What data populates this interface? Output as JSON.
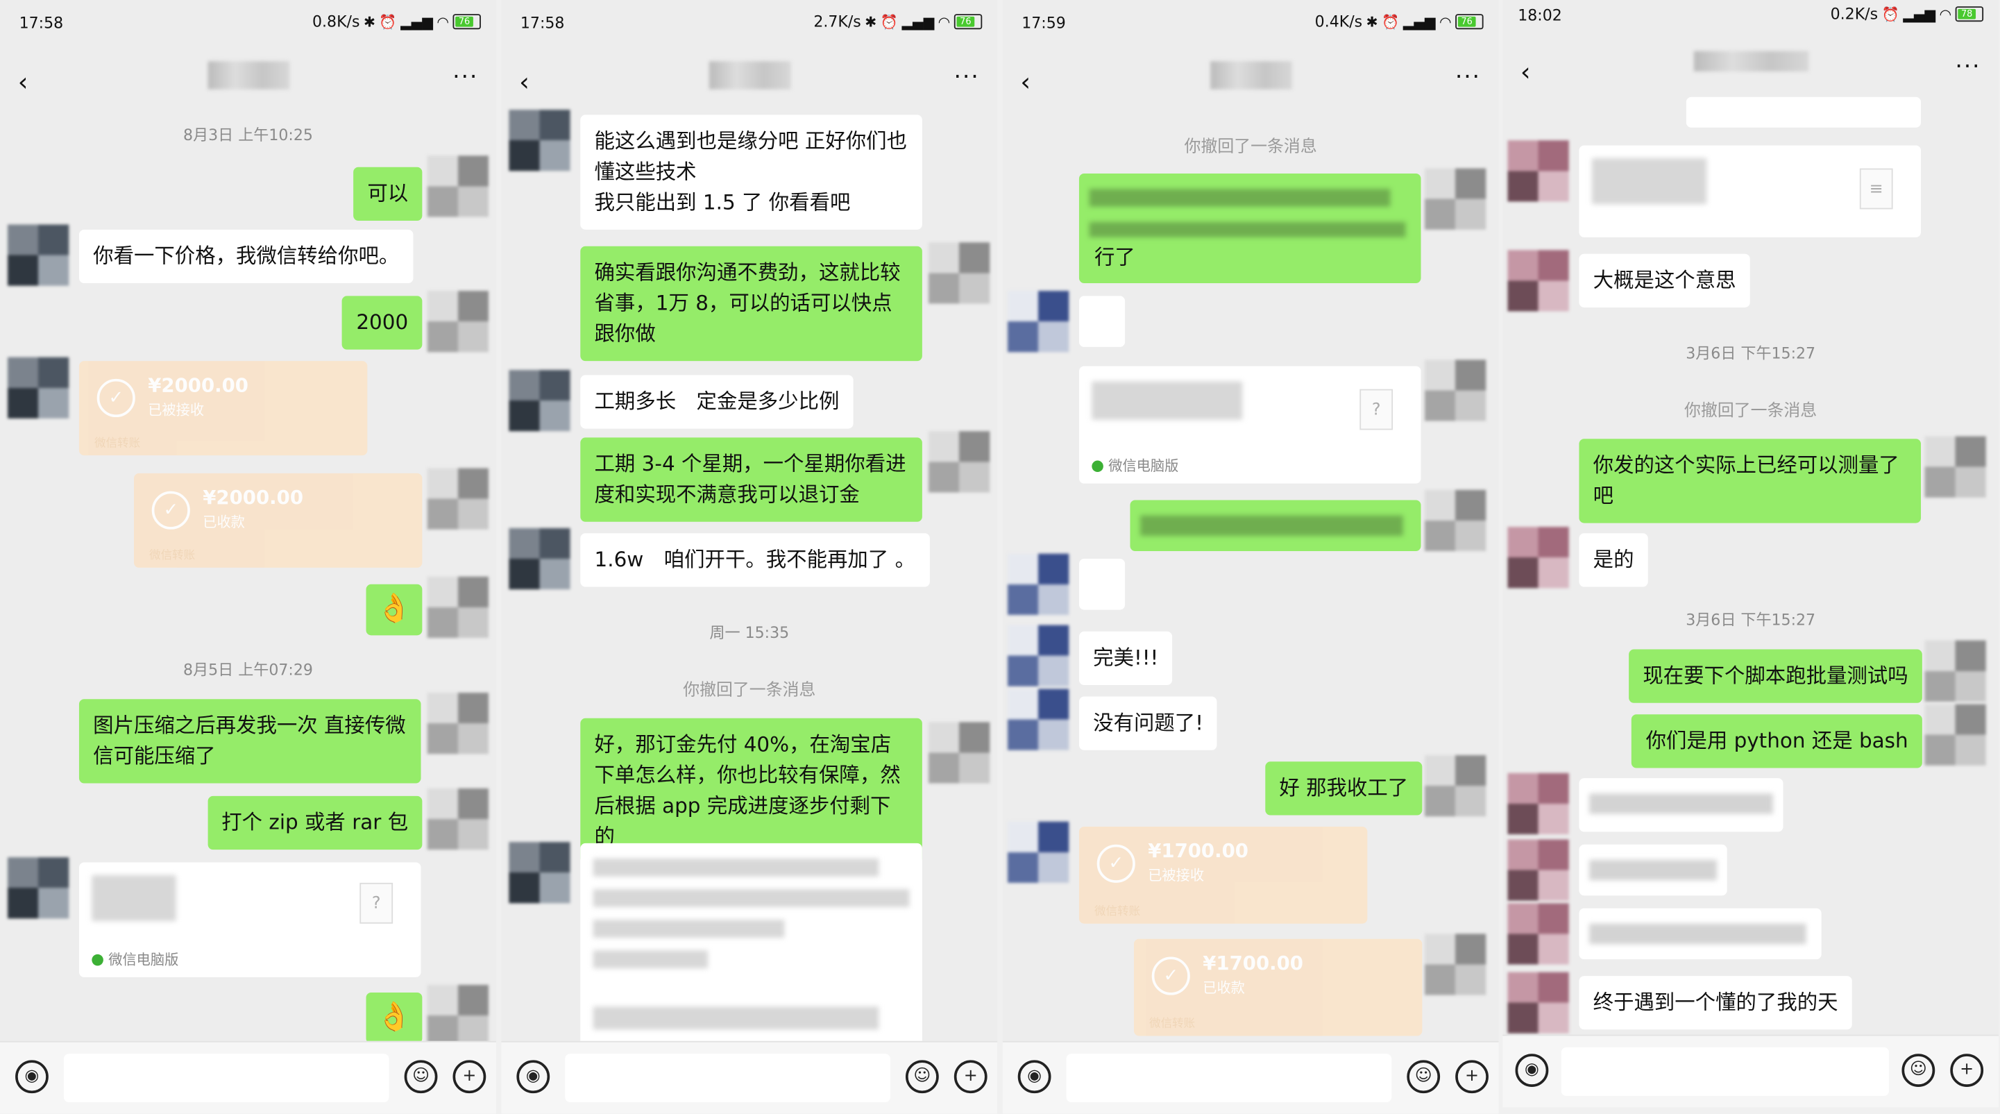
{
  "panels": [
    {
      "time": "17:58",
      "speed": "0.8K/s",
      "battery": "76"
    },
    {
      "time": "17:58",
      "speed": "2.7K/s",
      "battery": "76"
    },
    {
      "time": "17:59",
      "speed": "0.4K/s",
      "battery": "76"
    },
    {
      "time": "18:02",
      "speed": "0.2K/s",
      "battery": "78"
    }
  ],
  "p1": {
    "ts1": "8月3日 上午10:25",
    "m1": "可以",
    "m2": "你看一下价格，我微信转给你吧。",
    "m3": "2000",
    "t1_amt": "¥2000.00",
    "t1_status": "已被接收",
    "t1_foot": "微信转账",
    "t2_amt": "¥2000.00",
    "t2_status": "已收款",
    "t2_foot": "微信转账",
    "ts2": "8月5日 上午07:29",
    "m4": "图片压缩之后再发我一次 直接传微信可能压缩了",
    "m5": "打个 zip 或者 rar 包",
    "file_src": "微信电脑版"
  },
  "p2": {
    "m1": "能这么遇到也是缘分吧 正好你们也懂这些技术\n我只能出到 1.5 了 你看看吧",
    "m2": "确实看跟你沟通不费劲，这就比较省事，1万 8，可以的话可以快点跟你做",
    "m3": "工期多长　定金是多少比例",
    "m4": "工期 3-4 个星期，一个星期你看进度和实现不满意我可以退订金",
    "m5": "1.6w　咱们开干。我不能再加了 。",
    "ts1": "周一 15:35",
    "recall": "你撤回了一条消息",
    "m6": "好，那订金先付 40%，在淘宝店下单怎么样，你也比较有保障，然后根据 app 完成进度逐步付剩下的"
  },
  "p3": {
    "recall": "你撤回了一条消息",
    "m1_tail": "行了",
    "file_src": "微信电脑版",
    "m2": "完美!!!",
    "m3": "没有问题了!",
    "m4": "好 那我收工了",
    "t1_amt": "¥1700.00",
    "t1_status": "已被接收",
    "t1_foot": "微信转账",
    "t2_amt": "¥1700.00",
    "t2_status": "已收款",
    "t2_foot": "微信转账"
  },
  "p4": {
    "m1": "大概是这个意思",
    "ts1": "3月6日 下午15:27",
    "recall": "你撤回了一条消息",
    "m2": "你发的这个实际上已经可以测量了吧",
    "m3": "是的",
    "ts2": "3月6日 下午15:27",
    "m4": "现在要下个脚本跑批量测试吗",
    "m5": "你们是用 python 还是 bash",
    "m6": "终于遇到一个懂的了我的天"
  },
  "icons": {
    "back": "back-arrow-icon",
    "more": "more-icon",
    "voice": "voice-icon",
    "emoji": "emoji-icon",
    "plus": "plus-icon",
    "doc": "document-icon"
  }
}
